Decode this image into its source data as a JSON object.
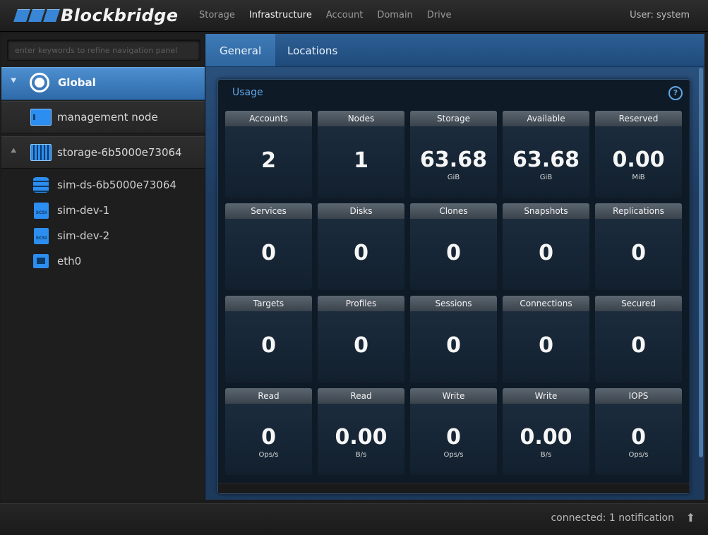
{
  "app": {
    "logo_text": "Blockbridge",
    "user_label": "User: system"
  },
  "nav": {
    "items": [
      {
        "label": "Storage",
        "active": false
      },
      {
        "label": "Infrastructure",
        "active": true
      },
      {
        "label": "Account",
        "active": false
      },
      {
        "label": "Domain",
        "active": false
      },
      {
        "label": "Drive",
        "active": false
      }
    ]
  },
  "sidebar": {
    "search_placeholder": "enter keywords to refine navigation panel",
    "global_label": "Global",
    "management_label": "management node",
    "storage_label": "storage-6b5000e73064",
    "leaves": [
      {
        "label": "sim-ds-6b5000e73064",
        "icon": "datastore-icon"
      },
      {
        "label": "sim-dev-1",
        "icon": "scsi-icon"
      },
      {
        "label": "sim-dev-2",
        "icon": "scsi-icon"
      },
      {
        "label": "eth0",
        "icon": "ethernet-icon"
      }
    ],
    "scsi_text": "SCSI"
  },
  "tabs": [
    {
      "label": "General"
    },
    {
      "label": "Locations"
    }
  ],
  "usage": {
    "title": "Usage",
    "help": "?",
    "tiles": [
      {
        "label": "Accounts",
        "value": "2",
        "unit": ""
      },
      {
        "label": "Nodes",
        "value": "1",
        "unit": ""
      },
      {
        "label": "Storage",
        "value": "63.68",
        "unit": "GiB"
      },
      {
        "label": "Available",
        "value": "63.68",
        "unit": "GiB"
      },
      {
        "label": "Reserved",
        "value": "0.00",
        "unit": "MiB"
      },
      {
        "label": "Services",
        "value": "0",
        "unit": ""
      },
      {
        "label": "Disks",
        "value": "0",
        "unit": ""
      },
      {
        "label": "Clones",
        "value": "0",
        "unit": ""
      },
      {
        "label": "Snapshots",
        "value": "0",
        "unit": ""
      },
      {
        "label": "Replications",
        "value": "0",
        "unit": ""
      },
      {
        "label": "Targets",
        "value": "0",
        "unit": ""
      },
      {
        "label": "Profiles",
        "value": "0",
        "unit": ""
      },
      {
        "label": "Sessions",
        "value": "0",
        "unit": ""
      },
      {
        "label": "Connections",
        "value": "0",
        "unit": ""
      },
      {
        "label": "Secured",
        "value": "0",
        "unit": ""
      },
      {
        "label": "Read",
        "value": "0",
        "unit": "Ops/s"
      },
      {
        "label": "Read",
        "value": "0.00",
        "unit": "B/s"
      },
      {
        "label": "Write",
        "value": "0",
        "unit": "Ops/s"
      },
      {
        "label": "Write",
        "value": "0.00",
        "unit": "B/s"
      },
      {
        "label": "IOPS",
        "value": "0",
        "unit": "Ops/s"
      }
    ]
  },
  "status": {
    "text": "connected: 1 notification"
  },
  "colors": {
    "accent": "#2c8ef0",
    "tab_bar": "#1e4a7a",
    "panel": "#0f1a27"
  }
}
